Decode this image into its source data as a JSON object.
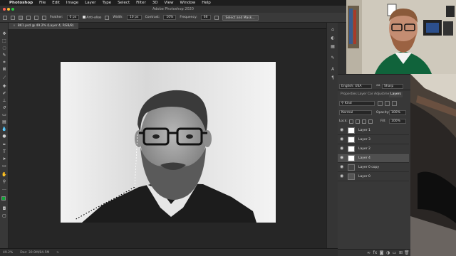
{
  "menubar": {
    "items": [
      "Photoshop",
      "File",
      "Edit",
      "Image",
      "Layer",
      "Type",
      "Select",
      "Filter",
      "3D",
      "View",
      "Window",
      "Help"
    ]
  },
  "titlebar": {
    "title": "Adobe Photoshop 2020"
  },
  "options": {
    "feather_label": "Feather:",
    "feather_value": "0 px",
    "antialias_label": "Anti-alias",
    "width_label": "Width:",
    "width_value": "10 px",
    "contrast_label": "Contrast:",
    "contrast_value": "10%",
    "frequency_label": "Frequency:",
    "frequency_value": "66",
    "select_mask_label": "Select and Mask..."
  },
  "document": {
    "tab_title": "BK1.psd @ 49.2% (Layer 4, RGB/8)",
    "close": "×"
  },
  "status": {
    "zoom": "49.2%",
    "doc": "Doc: 30.9M/84.5M",
    "arrow": ">"
  },
  "char_panel": {
    "language": "English: USA",
    "aa_label": "aa",
    "aa_value": "Sharp"
  },
  "layers_panel": {
    "tabs": [
      "Properties",
      "Layer Cor",
      "Adjustme",
      "Layers"
    ],
    "kind_label": "Kind",
    "blend_mode": "Normal",
    "opacity_label": "Opacity:",
    "opacity_value": "100%",
    "lock_label": "Lock:",
    "fill_label": "Fill:",
    "fill_value": "100%",
    "layers": [
      {
        "name": "Layer 1",
        "selected": false
      },
      {
        "name": "Layer 3",
        "selected": false
      },
      {
        "name": "Layer 2",
        "selected": false
      },
      {
        "name": "Layer 4",
        "selected": true
      },
      {
        "name": "Layer 0 copy",
        "selected": false
      },
      {
        "name": "Layer 0",
        "selected": false
      }
    ]
  },
  "colors": {
    "accent": "#2d7fd3",
    "foreground_swatch": "#13a538",
    "panel": "#383838"
  }
}
